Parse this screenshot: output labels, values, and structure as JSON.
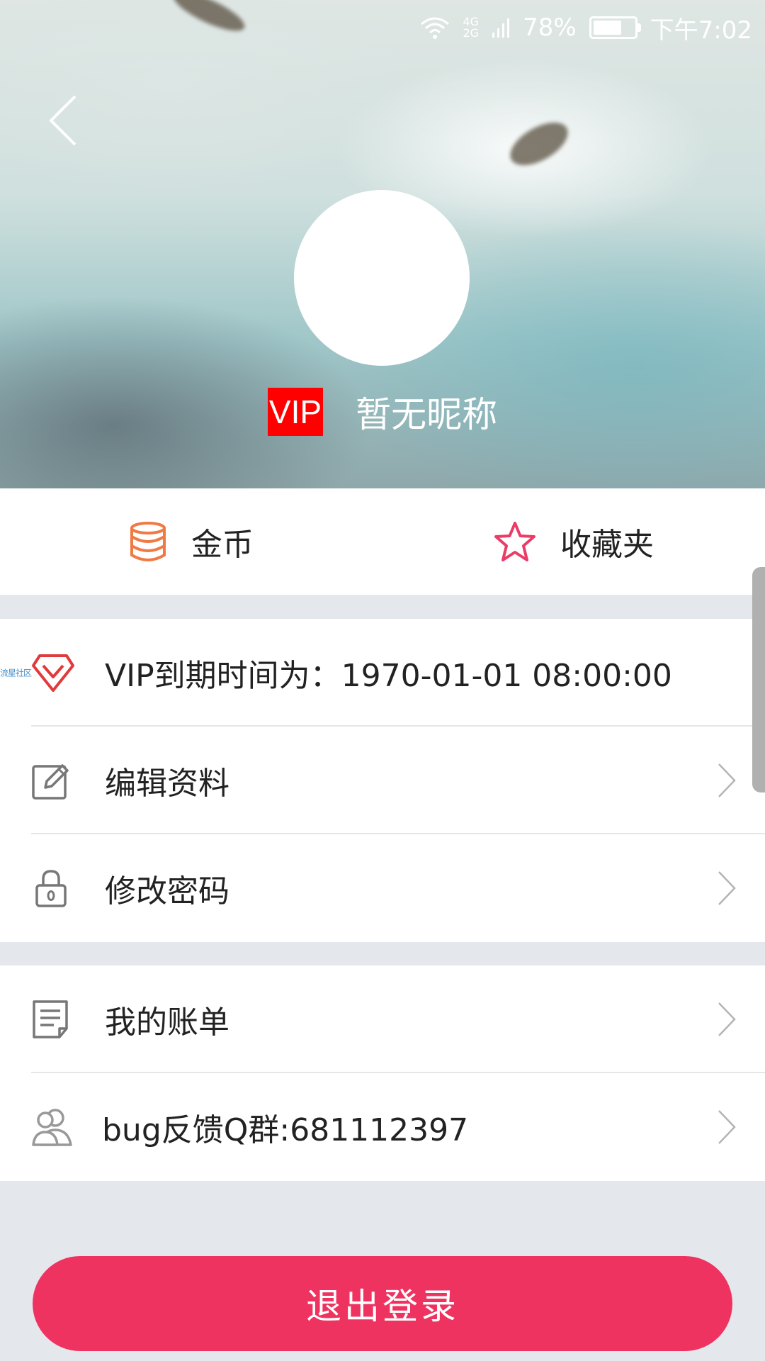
{
  "status_bar": {
    "network_top": "4G",
    "network_bottom": "2G",
    "battery": "78%",
    "battery_level": 0.78,
    "time": "下午7:02"
  },
  "profile": {
    "vip_badge": "VIP",
    "nickname": "暂无昵称"
  },
  "quick_actions": [
    {
      "label": "金币",
      "icon": "coins-icon",
      "color": "#f07a43"
    },
    {
      "label": "收藏夹",
      "icon": "star-icon",
      "color": "#ec3b67"
    }
  ],
  "vip_row": {
    "watermark": "流星社区",
    "text": "VIP到期时间为：1970-01-01 08:00:00"
  },
  "menu_group_1": [
    {
      "label": "编辑资料",
      "icon": "edit-icon"
    },
    {
      "label": "修改密码",
      "icon": "lock-icon"
    }
  ],
  "menu_group_2": [
    {
      "label": "我的账单",
      "icon": "bill-icon"
    },
    {
      "label": "bug反馈Q群:681112397",
      "icon": "users-icon"
    }
  ],
  "logout_label": "退出登录",
  "colors": {
    "accent": "#ef3360",
    "vip_red": "#ff0000",
    "coin_orange": "#f07a43"
  }
}
